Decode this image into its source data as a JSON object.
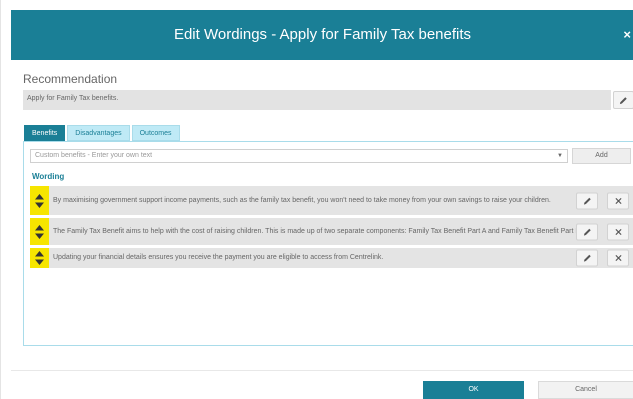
{
  "dialog": {
    "title": "Edit Wordings - Apply for Family Tax benefits",
    "close_label": "×"
  },
  "recommendation": {
    "heading": "Recommendation",
    "text": "Apply for Family Tax benefits."
  },
  "tabs": [
    {
      "label": "Benefits",
      "active": true
    },
    {
      "label": "Disadvantages",
      "active": false
    },
    {
      "label": "Outcomes",
      "active": false
    }
  ],
  "selector": {
    "selected": "Custom benefits - Enter your own text",
    "add_label": "Add"
  },
  "wording": {
    "label": "Wording",
    "items": [
      {
        "text": "By maximising government support income payments, such as the family tax benefit, you won't need to take money from your own savings to raise your children."
      },
      {
        "text": "The Family Tax Benefit aims to help with the cost of raising children. This is made up of two separate components: Family Tax Benefit Part A and Family Tax Benefit Part B."
      },
      {
        "text": "Updating your financial details ensures you receive the payment you are eligible to access from Centrelink."
      }
    ]
  },
  "footer": {
    "ok_label": "OK",
    "cancel_label": "Cancel"
  },
  "colors": {
    "accent": "#1a7f96",
    "tab_inactive": "#bfeaf6",
    "drag_handle": "#f6e500",
    "row_bg": "#e4e4e4"
  },
  "icons": {
    "edit": "pencil-icon",
    "delete": "close-icon",
    "drag": "sort-arrows-icon",
    "dropdown": "caret-down-icon"
  }
}
